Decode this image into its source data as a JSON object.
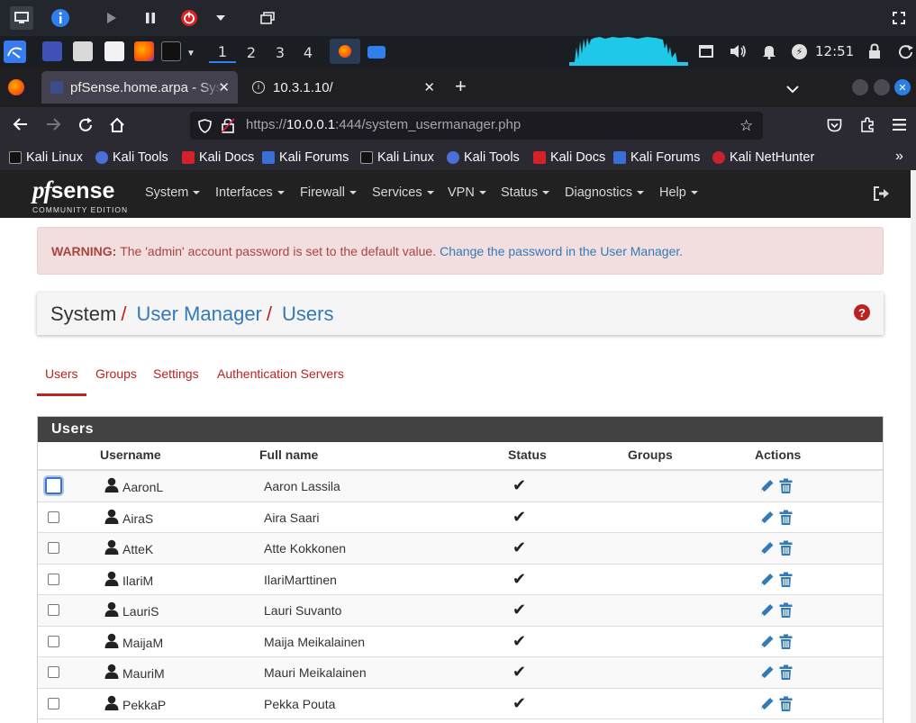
{
  "vm_toolbar": {
    "icons": [
      "monitor-icon",
      "info-icon",
      "play-icon",
      "pause-icon",
      "power-icon",
      "dropdown-icon",
      "windows-icon",
      "fullscreen-icon"
    ]
  },
  "taskbar": {
    "workspaces": [
      "1",
      "2",
      "3",
      "4"
    ],
    "time": "12:51"
  },
  "browser": {
    "tabs": [
      {
        "title": "pfSense.home.arpa - Syst",
        "active": true
      },
      {
        "title": "10.3.1.10/",
        "active": false
      }
    ],
    "url_prefix": "https://",
    "url_host": "10.0.0.1",
    "url_rest": ":444/system_usermanager.php",
    "bookmarks": [
      "Kali Linux",
      "Kali Tools",
      "Kali Docs",
      "Kali Forums",
      "Kali Linux",
      "Kali Tools",
      "Kali Docs",
      "Kali Forums",
      "Kali NetHunter"
    ]
  },
  "pfsense": {
    "logo_pf": "pf",
    "logo_sense": "sense",
    "logo_edition": "COMMUNITY EDITION",
    "menu": [
      "System",
      "Interfaces",
      "Firewall",
      "Services",
      "VPN",
      "Status",
      "Diagnostics",
      "Help"
    ],
    "warning": {
      "label": "WARNING:",
      "text": "The 'admin' account password is set to the default value.",
      "link": "Change the password in the User Manager."
    },
    "breadcrumb": [
      "System",
      "User Manager",
      "Users"
    ],
    "tabs": [
      "Users",
      "Groups",
      "Settings",
      "Authentication Servers"
    ],
    "panel_title": "Users",
    "columns": [
      "Username",
      "Full name",
      "Status",
      "Groups",
      "Actions"
    ],
    "users": [
      {
        "username": "AaronL",
        "fullname": "Aaron Lassila"
      },
      {
        "username": "AiraS",
        "fullname": "Aira Saari"
      },
      {
        "username": "AtteK",
        "fullname": "Atte Kokkonen"
      },
      {
        "username": "IlariM",
        "fullname": "IlariMarttinen"
      },
      {
        "username": "LauriS",
        "fullname": "Lauri Suvanto"
      },
      {
        "username": "MaijaM",
        "fullname": "Maija Meikalainen"
      },
      {
        "username": "MauriM",
        "fullname": "Mauri Meikalainen"
      },
      {
        "username": "PekkaP",
        "fullname": "Pekka Pouta"
      }
    ],
    "status_check": "✔"
  },
  "colors": {
    "brand_red": "#b22222",
    "link_blue": "#337ab7",
    "nav_dark": "#212121"
  }
}
